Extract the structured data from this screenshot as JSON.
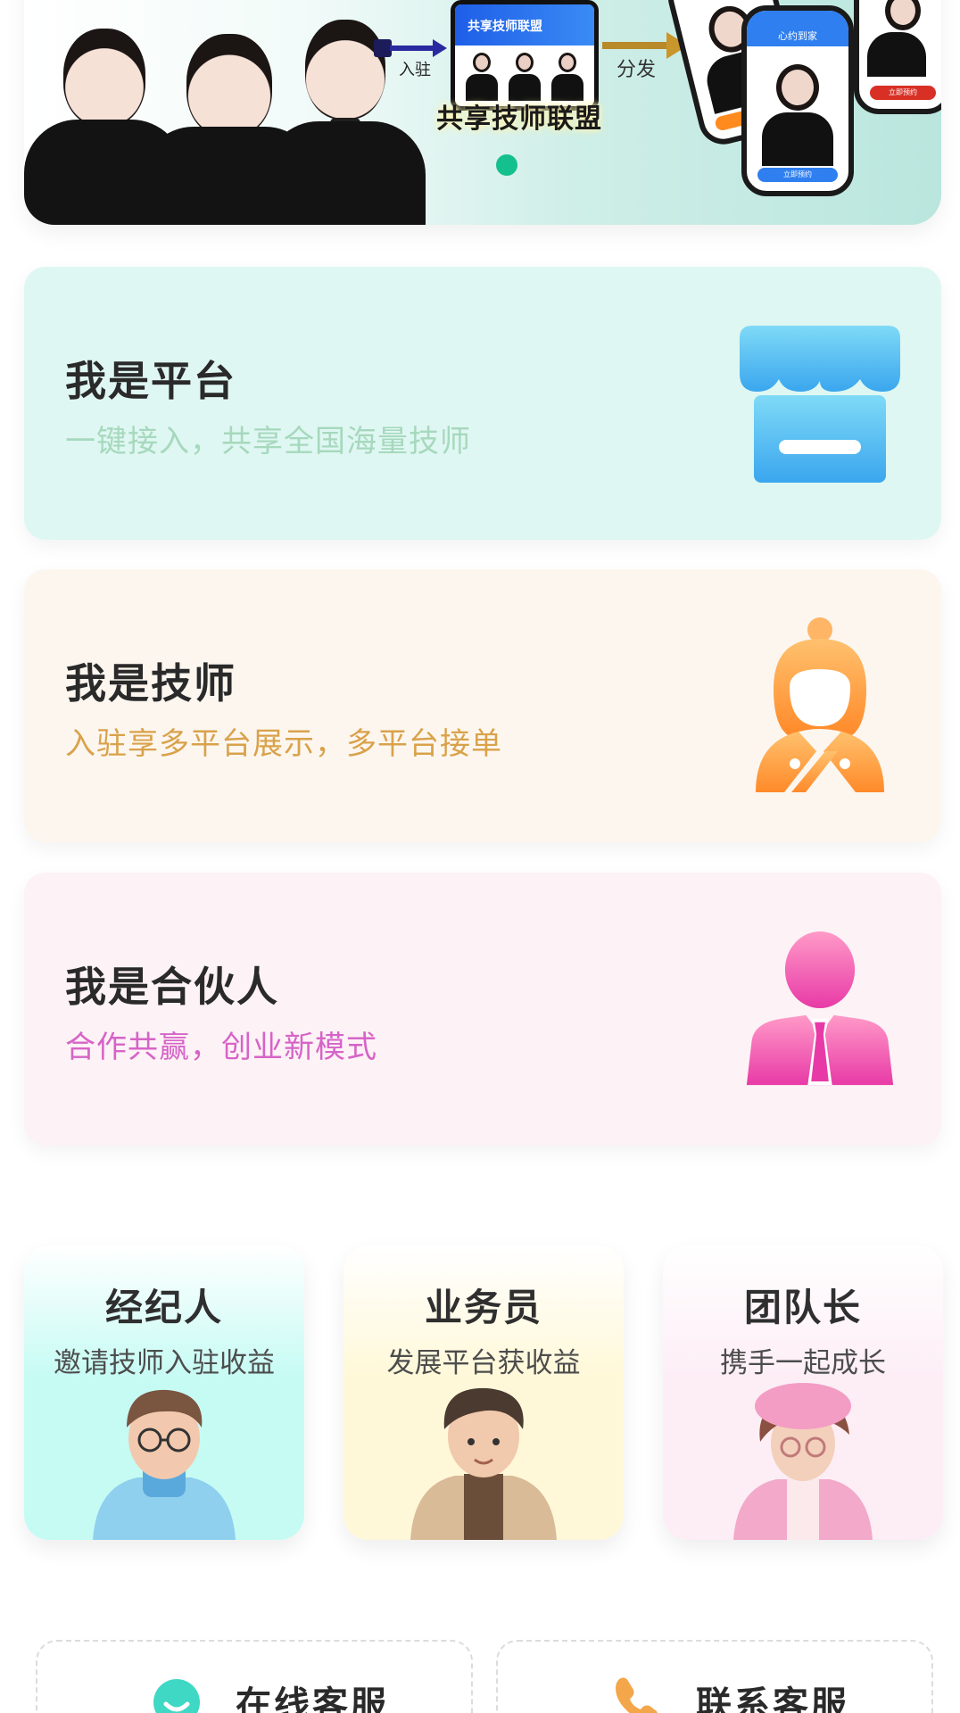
{
  "banner": {
    "arrow1_label": "入驻",
    "arrow2_label": "分发",
    "alliance_card_header": "共享技师联盟",
    "alliance_title": "共享技师联盟",
    "phone_header": "心约到家",
    "phone_button": "立即预约",
    "phone_button_alt": "立即预约",
    "carousel_dots": 1
  },
  "roles": [
    {
      "title": "我是平台",
      "subtitle": "一键接入，共享全国海量技师",
      "subtitle_color": "#a6d8bd",
      "bg": "#dff7f2",
      "icon": "store-icon"
    },
    {
      "title": "我是技师",
      "subtitle": "入驻享多平台展示，多平台接单",
      "subtitle_color": "#d9a24a",
      "bg": "#fcf6ef",
      "icon": "technician-icon"
    },
    {
      "title": "我是合伙人",
      "subtitle": "合作共赢，创业新模式",
      "subtitle_color": "#d664c7",
      "bg": "#fdf2f6",
      "icon": "partner-icon"
    }
  ],
  "mini_cards": [
    {
      "title": "经纪人",
      "subtitle": "邀请技师入驻收益",
      "bg": "#c6fbf4",
      "icon": "agent-avatar"
    },
    {
      "title": "业务员",
      "subtitle": "发展平台获收益",
      "bg": "#fff8d8",
      "icon": "salesman-avatar"
    },
    {
      "title": "团队长",
      "subtitle": "携手一起成长",
      "bg": "#fdeef6",
      "icon": "team-leader-avatar"
    }
  ],
  "services": [
    {
      "label": "在线客服",
      "icon": "chat-icon",
      "color": "#3fd8c4"
    },
    {
      "label": "联系客服",
      "icon": "phone-icon",
      "color": "#f3a64a"
    }
  ]
}
